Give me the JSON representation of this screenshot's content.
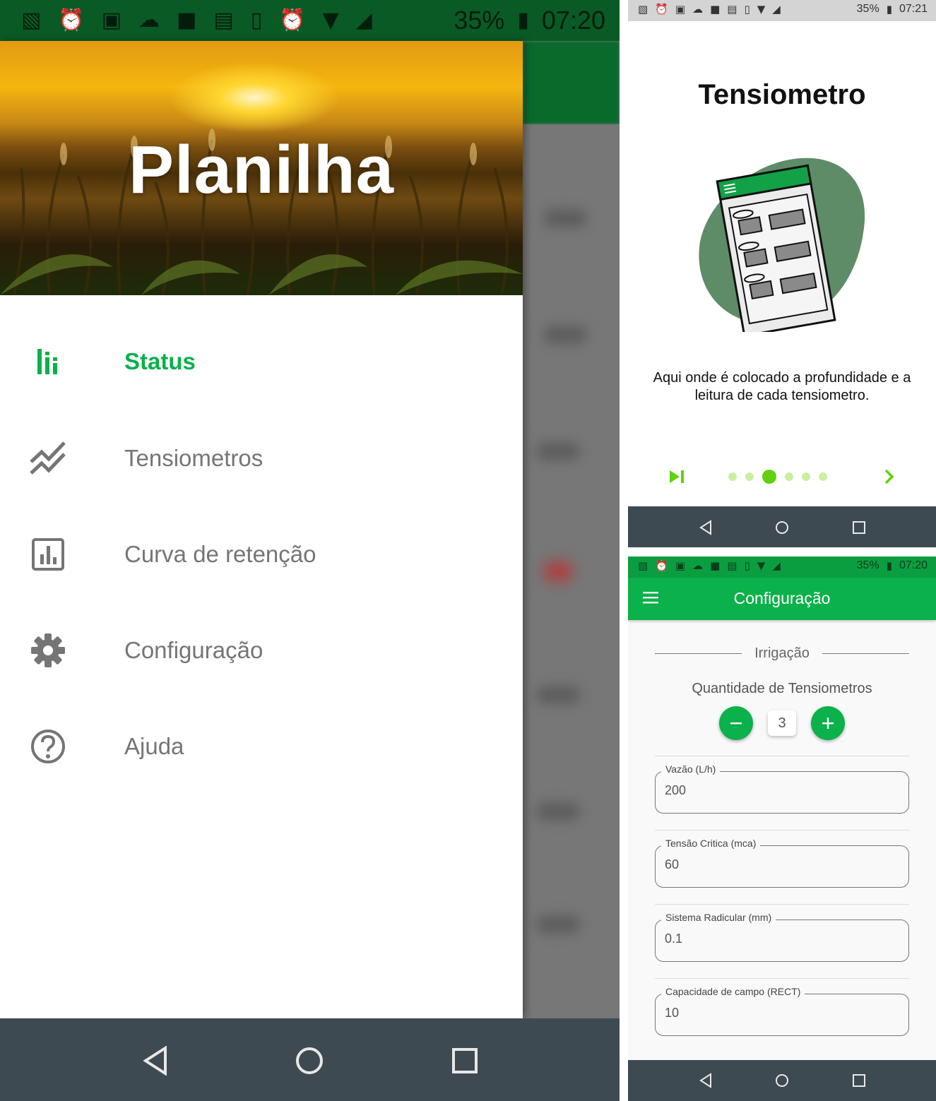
{
  "left_screen": {
    "status_bar": {
      "battery": "35%",
      "time": "07:20"
    },
    "drawer": {
      "header_title": "Planilha",
      "items": [
        {
          "label": "Status",
          "icon": "bar-chart-icon",
          "active": true
        },
        {
          "label": "Tensiometros",
          "icon": "trending-lines-icon",
          "active": false
        },
        {
          "label": "Curva de retenção",
          "icon": "chart-box-icon",
          "active": false
        },
        {
          "label": "Configuração",
          "icon": "gear-icon",
          "active": false
        },
        {
          "label": "Ajuda",
          "icon": "help-circle-icon",
          "active": false
        }
      ]
    },
    "nav_bar": [
      "back-icon",
      "home-icon",
      "recents-icon"
    ]
  },
  "onboarding_screen": {
    "status_bar": {
      "battery": "35%",
      "time": "07:21"
    },
    "title": "Tensiometro",
    "description": "Aqui onde é colocado a profundidade e a leitura de cada tensiometro.",
    "pager": {
      "total_pages": 6,
      "current_page": 3
    },
    "skip_icon": "skip-next-icon",
    "next_icon": "chevron-right-icon"
  },
  "config_screen": {
    "status_bar": {
      "battery": "35%",
      "time": "07:20"
    },
    "app_bar_title": "Configuração",
    "section_title": "Irrigação",
    "quantity": {
      "label": "Quantidade de Tensiometros",
      "value": "3"
    },
    "fields": [
      {
        "label": "Vazão (L/h)",
        "value": "200"
      },
      {
        "label": "Tensão Critica (mca)",
        "value": "60"
      },
      {
        "label": "Sistema Radicular (mm)",
        "value": "0.1"
      },
      {
        "label": "Capacidade de campo (RECT)",
        "value": "10"
      }
    ]
  },
  "colors": {
    "primary_green": "#0bb14a",
    "active_item_green": "#0cb04b",
    "pager_dot_active": "#5fd10f",
    "pager_dot_inactive": "#cceea0",
    "nav_bar": "#3e4a51",
    "illustration_blob": "#5e8c66"
  }
}
